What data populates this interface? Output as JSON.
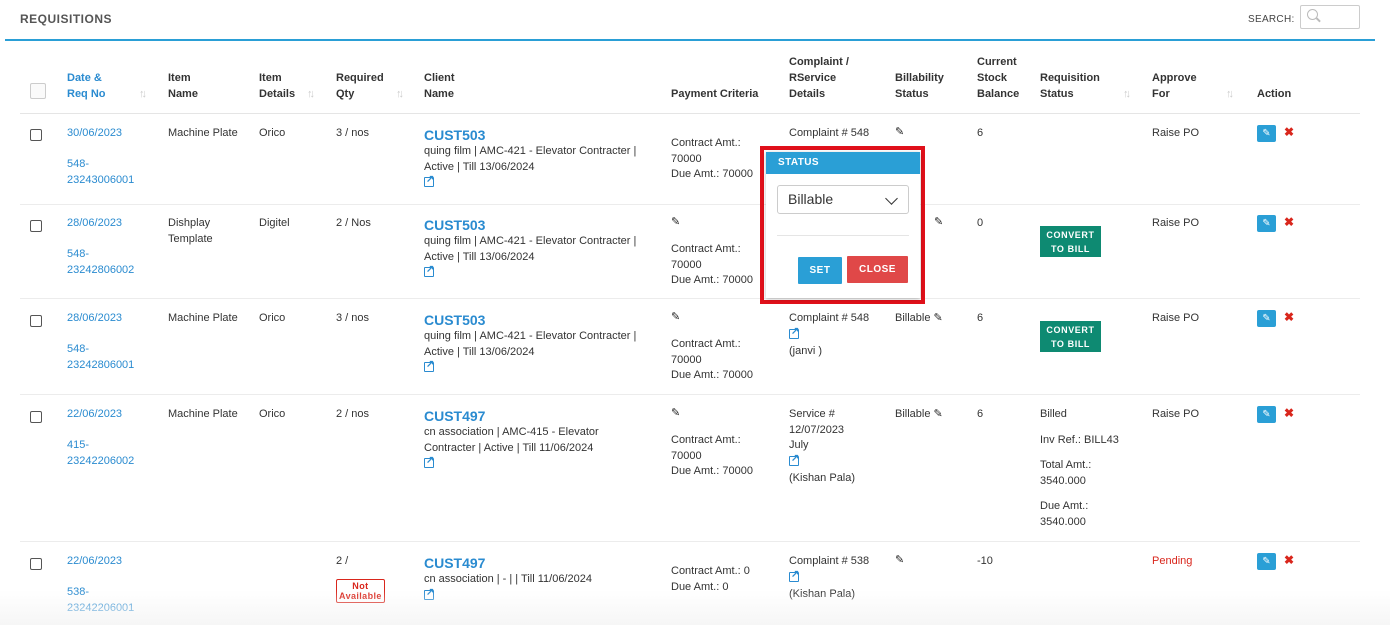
{
  "page": {
    "title": "REQUISITIONS",
    "search_label": "SEARCH:",
    "search_value": ""
  },
  "columns": {
    "date_req": [
      "Date &",
      "Req No"
    ],
    "item_name": [
      "Item",
      "Name"
    ],
    "item_details": [
      "Item",
      "Details"
    ],
    "required_qty": [
      "Required",
      "Qty"
    ],
    "client_name": [
      "Client",
      "Name"
    ],
    "payment_criteria": "Payment Criteria",
    "complaint": [
      "Complaint /",
      "RService",
      "Details"
    ],
    "billability": [
      "Billability",
      "Status"
    ],
    "stock": [
      "Current",
      "Stock",
      "Balance"
    ],
    "req_status": [
      "Requisition",
      "Status"
    ],
    "approve_for": [
      "Approve",
      "For"
    ],
    "action": "Action"
  },
  "rows": [
    {
      "date": "30/06/2023",
      "req_no": [
        "548-",
        "23243006001"
      ],
      "item_name": [
        "Machine Plate"
      ],
      "item_details": "Orico",
      "qty": "3 / nos",
      "cust": "CUST503",
      "client_info": [
        "quing film | AMC-421 - Elevator Contracter |",
        "Active | Till 13/06/2024"
      ],
      "payment": [
        "Contract Amt.:",
        "70000",
        "Due Amt.: 70000"
      ],
      "complaint": [
        "Complaint # 548"
      ],
      "billability": "",
      "stock": "6",
      "req_status": [],
      "approve": "Raise PO"
    },
    {
      "date": "28/06/2023",
      "req_no": [
        "548-",
        "23242806002"
      ],
      "item_name": [
        "Dishplay",
        "Template"
      ],
      "item_details": "Digitel",
      "qty": "2 / Nos",
      "cust": "CUST503",
      "client_info": [
        "quing film | AMC-421 - Elevator Contracter |",
        "Active | Till 13/06/2024"
      ],
      "payment": [
        "Contract Amt.:",
        "70000",
        "Due Amt.: 70000"
      ],
      "complaint": [],
      "billability": "",
      "stock": "0",
      "convert_label": [
        "CONVERT",
        "TO BILL"
      ],
      "req_status": [],
      "approve": "Raise PO"
    },
    {
      "date": "28/06/2023",
      "req_no": [
        "548-",
        "23242806001"
      ],
      "item_name": [
        "Machine Plate"
      ],
      "item_details": "Orico",
      "qty": "3 / nos",
      "cust": "CUST503",
      "client_info": [
        "quing film | AMC-421 - Elevator Contracter |",
        "Active | Till 13/06/2024"
      ],
      "payment": [
        "Contract Amt.:",
        "70000",
        "Due Amt.: 70000"
      ],
      "complaint": [
        "Complaint # 548",
        "(janvi )"
      ],
      "billability": "Billable",
      "stock": "6",
      "convert_label": [
        "CONVERT",
        "TO BILL"
      ],
      "req_status": [],
      "approve": "Raise PO"
    },
    {
      "date": "22/06/2023",
      "req_no": [
        "415-",
        "23242206002"
      ],
      "item_name": [
        "Machine Plate"
      ],
      "item_details": "Orico",
      "qty": "2 / nos",
      "cust": "CUST497",
      "client_info": [
        "cn association | AMC-415 - Elevator",
        "Contracter | Active | Till 11/06/2024"
      ],
      "payment": [
        "Contract Amt.:",
        "70000",
        "Due Amt.: 70000"
      ],
      "complaint": [
        "Service #",
        "12/07/2023",
        "July",
        "(Kishan Pala)"
      ],
      "billability": "Billable",
      "stock": "6",
      "req_status": [
        "Billed",
        "Inv Ref.: BILL43",
        "Total Amt.:",
        "3540.000",
        "Due Amt.:",
        "3540.000"
      ],
      "approve": "Raise PO"
    },
    {
      "date": "22/06/2023",
      "req_no": [
        "538-",
        "23242206001"
      ],
      "item_name": [],
      "item_details": "",
      "qty": "2 /",
      "not_available": [
        "Not",
        "Available"
      ],
      "cust": "CUST497",
      "client_info": [
        "cn association | - | | Till 11/06/2024"
      ],
      "payment": [
        "Contract Amt.: 0",
        "Due Amt.: 0"
      ],
      "complaint": [
        "Complaint # 538",
        "(Kishan Pala)"
      ],
      "billability": "",
      "stock": "-10",
      "req_status": [],
      "approve": "Pending"
    }
  ],
  "status_popup": {
    "title": "STATUS",
    "selected": "Billable",
    "set_label": "SET",
    "close_label": "CLOSE"
  },
  "icons": {
    "edit": "pencil-icon",
    "external": "external-link-icon",
    "delete": "delete-icon",
    "search": "search-icon"
  },
  "colors": {
    "accent": "#2a9fd6",
    "link": "#2a8bd0",
    "convert": "#0e8a72",
    "danger": "#d9261c",
    "highlight": "#e0101a"
  }
}
